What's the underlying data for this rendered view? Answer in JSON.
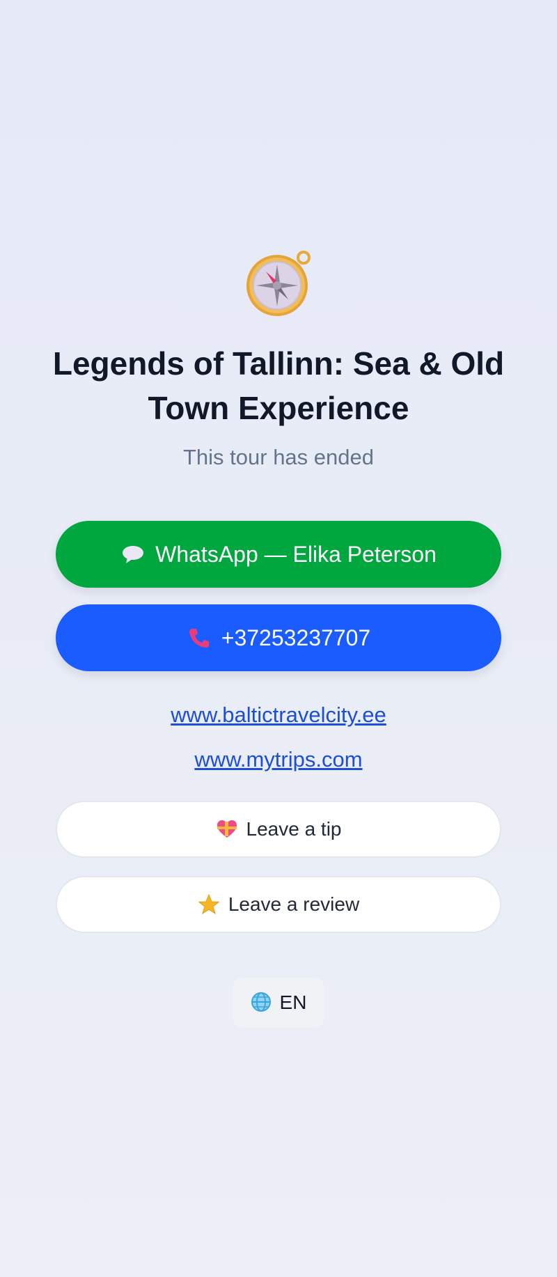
{
  "header": {
    "icon": "compass-icon",
    "title": "Legends of Tallinn: Sea & Old Town Experience",
    "subtitle": "This tour has ended"
  },
  "contact": {
    "whatsapp_label": "WhatsApp — Elika Peterson",
    "whatsapp_icon": "speech-bubble-icon",
    "whatsapp_color": "#00a63e",
    "phone_label": "+37253237707",
    "phone_icon": "phone-icon",
    "phone_color": "#1a5cff"
  },
  "links": [
    {
      "label": "www.baltictravelcity.ee"
    },
    {
      "label": "www.mytrips.com"
    }
  ],
  "actions": {
    "tip_label": "Leave a tip",
    "tip_icon": "heart-gift-icon",
    "review_label": "Leave a review",
    "review_icon": "star-icon"
  },
  "language": {
    "icon": "globe-icon",
    "label": "EN"
  }
}
